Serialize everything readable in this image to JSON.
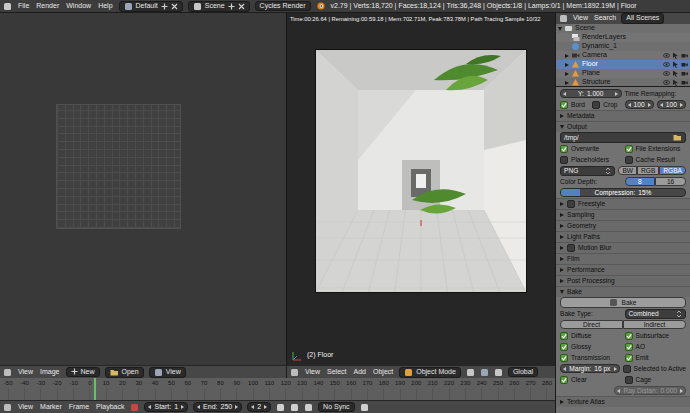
{
  "topbar": {
    "menus": [
      "File",
      "Render",
      "Window",
      "Help"
    ],
    "layout": "Default",
    "scene": "Scene",
    "engine": "Cycles Render",
    "stats": "v2.79 | Verts:18,720 | Faces:18,124 | Tris:36,248 | Objects:1/8 | Lamps:0/1 | Mem:1892.19M | Floor"
  },
  "image_editor": {
    "menus": [
      "View",
      "Image"
    ],
    "new_button": "New",
    "open_button": "Open",
    "view_menu": "View"
  },
  "viewport": {
    "render_info": "Time:00:26.64 | Remaining:00:59.18 | Mem:702.71M, Peak:783.78M | Path Tracing Sample 10/32",
    "object_label": "(2) Floor",
    "menus": [
      "View",
      "Select",
      "Add",
      "Object"
    ],
    "mode": "Object Mode",
    "orientation": "Global"
  },
  "outliner": {
    "menus": [
      "View",
      "Search"
    ],
    "filter": "All Scenes",
    "items": [
      {
        "label": "Scene",
        "kind": "scene",
        "expanded": true,
        "selected": false
      },
      {
        "label": "RenderLayers",
        "kind": "layers",
        "selected": false
      },
      {
        "label": "Dynamic_1",
        "kind": "world",
        "selected": false
      },
      {
        "label": "Camera",
        "kind": "camera",
        "expanded": false,
        "selected": false
      },
      {
        "label": "Floor",
        "kind": "mesh",
        "expanded": false,
        "selected": true
      },
      {
        "label": "Plane",
        "kind": "mesh",
        "expanded": false,
        "selected": false
      },
      {
        "label": "Structure",
        "kind": "mesh",
        "expanded": false,
        "selected": false
      }
    ]
  },
  "properties": {
    "rows": [
      {
        "kind": "row",
        "cells": [
          {
            "kind": "number",
            "label": "Y:",
            "value": "1.000"
          },
          {
            "kind": "label",
            "text": "Time Remapping:"
          }
        ]
      },
      {
        "kind": "row",
        "cells": [
          {
            "kind": "check",
            "text": "Bord",
            "checked": true
          },
          {
            "kind": "check",
            "text": "Crop",
            "checked": false
          },
          {
            "kind": "number",
            "value": "100"
          },
          {
            "kind": "number",
            "value": "100"
          }
        ]
      },
      {
        "kind": "panel",
        "text": "Metadata",
        "expanded": false
      },
      {
        "kind": "panel",
        "text": "Output",
        "expanded": true
      },
      {
        "kind": "row",
        "cells": [
          {
            "kind": "path",
            "text": "/tmp/"
          }
        ]
      },
      {
        "kind": "row",
        "cells": [
          {
            "kind": "check",
            "text": "Overwrite",
            "checked": true
          },
          {
            "kind": "check",
            "text": "File Extensions",
            "checked": true
          }
        ]
      },
      {
        "kind": "row",
        "cells": [
          {
            "kind": "check",
            "text": "Placeholders",
            "checked": false
          },
          {
            "kind": "check",
            "text": "Cache Result",
            "checked": false
          }
        ]
      },
      {
        "kind": "row",
        "cells": [
          {
            "kind": "dropdown",
            "text": "PNG"
          },
          {
            "kind": "toggle",
            "options": [
              {
                "text": "BW",
                "selected": false
              },
              {
                "text": "RGB",
                "selected": false
              },
              {
                "text": "RGBA",
                "selected": true
              }
            ]
          }
        ]
      },
      {
        "kind": "row",
        "cells": [
          {
            "kind": "label",
            "text": "Color Depth:"
          },
          {
            "kind": "toggle",
            "options": [
              {
                "text": "8",
                "selected": true
              },
              {
                "text": "16",
                "selected": false
              }
            ]
          }
        ]
      },
      {
        "kind": "row",
        "cells": [
          {
            "kind": "slider",
            "text": "Compression:",
            "value": "15%",
            "level": 0.15
          }
        ]
      },
      {
        "kind": "panel",
        "text": "Freestyle",
        "expanded": false,
        "checked": false
      },
      {
        "kind": "panel",
        "text": "Sampling",
        "expanded": false
      },
      {
        "kind": "panel",
        "text": "Geometry",
        "expanded": false
      },
      {
        "kind": "panel",
        "text": "Light Paths",
        "expanded": false
      },
      {
        "kind": "panel",
        "text": "Motion Blur",
        "expanded": false,
        "checked": false
      },
      {
        "kind": "panel",
        "text": "Film",
        "expanded": false
      },
      {
        "kind": "panel",
        "text": "Performance",
        "expanded": false
      },
      {
        "kind": "panel",
        "text": "Post Processing",
        "expanded": false
      },
      {
        "kind": "panel",
        "text": "Bake",
        "expanded": true
      },
      {
        "kind": "row",
        "cells": [
          {
            "kind": "button",
            "text": "Bake"
          }
        ]
      },
      {
        "kind": "row",
        "cells": [
          {
            "kind": "label",
            "text": "Bake Type:"
          },
          {
            "kind": "dropdown",
            "text": "Combined"
          }
        ]
      },
      {
        "kind": "row",
        "cells": [
          {
            "kind": "toggle",
            "options": [
              {
                "text": "Direct",
                "selected": false
              },
              {
                "text": "Indirect",
                "selected": false
              }
            ]
          }
        ]
      },
      {
        "kind": "row",
        "cells": [
          {
            "kind": "check",
            "text": "Diffuse",
            "checked": true
          },
          {
            "kind": "check",
            "text": "Subsurface",
            "checked": true
          }
        ]
      },
      {
        "kind": "row",
        "cells": [
          {
            "kind": "check",
            "text": "Glossy",
            "checked": true
          },
          {
            "kind": "check",
            "text": "AO",
            "checked": true
          }
        ]
      },
      {
        "kind": "row",
        "cells": [
          {
            "kind": "check",
            "text": "Transmission",
            "checked": true
          },
          {
            "kind": "check",
            "text": "Emit",
            "checked": true
          }
        ]
      },
      {
        "kind": "row",
        "cells": [
          {
            "kind": "number",
            "label": "Margin:",
            "value": "16 px"
          },
          {
            "kind": "check",
            "text": "Selected to Active",
            "checked": false
          }
        ]
      },
      {
        "kind": "row",
        "cells": [
          {
            "kind": "check",
            "text": "Clear",
            "checked": true
          },
          {
            "kind": "check",
            "text": "Cage",
            "checked": false
          }
        ]
      },
      {
        "kind": "row",
        "cells": [
          {
            "kind": "empty"
          },
          {
            "kind": "number",
            "label": "Ray Distan:",
            "value": "0.000",
            "disabled": true
          }
        ]
      },
      {
        "kind": "panel",
        "text": "Texture Atlas",
        "expanded": false
      }
    ]
  },
  "timeline": {
    "ticks": [
      "-50",
      "-40",
      "-30",
      "-20",
      "-10",
      "0",
      "10",
      "20",
      "30",
      "40",
      "50",
      "60",
      "70",
      "80",
      "90",
      "100",
      "110",
      "120",
      "130",
      "140",
      "150",
      "160",
      "170",
      "180",
      "190",
      "200",
      "210",
      "220",
      "230",
      "240",
      "250",
      "260",
      "270",
      "280"
    ],
    "playhead_level": 0.17,
    "menus": [
      "View",
      "Marker",
      "Frame",
      "Playback"
    ],
    "start": {
      "label": "Start:",
      "value": "1"
    },
    "end": {
      "label": "End:",
      "value": "250"
    },
    "current_frame": "2",
    "sync": "No Sync"
  }
}
